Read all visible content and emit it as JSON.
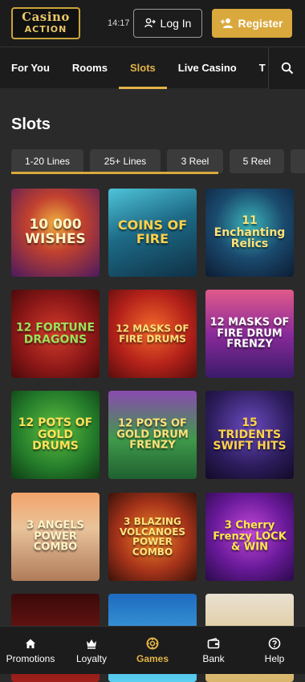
{
  "header": {
    "logo_line1": "Casino",
    "logo_line2": "ACTION",
    "time": "14:17",
    "login_label": "Log In",
    "register_label": "Register"
  },
  "nav": {
    "items": [
      "For You",
      "Rooms",
      "Slots",
      "Live Casino",
      "T"
    ],
    "active": "Slots"
  },
  "page_title": "Slots",
  "filters": [
    "1-20 Lines",
    "25+ Lines",
    "3 Reel",
    "5 Reel"
  ],
  "games": [
    {
      "title": "10 000 WISHES"
    },
    {
      "title": "COINS OF FIRE"
    },
    {
      "title": "11 Enchanting Relics"
    },
    {
      "title": "12 FORTUNE DRAGONS"
    },
    {
      "title": "12 MASKS OF FIRE DRUMS"
    },
    {
      "title": "12 MASKS OF FIRE DRUM FRENZY"
    },
    {
      "title": "12 POTS OF GOLD DRUMS"
    },
    {
      "title": "12 POTS OF GOLD DRUM FRENZY"
    },
    {
      "title": "15 TRIDENTS SWIFT HITS"
    },
    {
      "title": "3 ANGELS POWER COMBO"
    },
    {
      "title": "3 BLAZING VOLCANOES POWER COMBO"
    },
    {
      "title": "3 Cherry Frenzy LOCK & WIN"
    },
    {
      "title": ""
    },
    {
      "title": ""
    },
    {
      "title": ""
    }
  ],
  "bottom_nav": [
    {
      "label": "Promotions",
      "icon": "home-icon"
    },
    {
      "label": "Loyalty",
      "icon": "crown-icon"
    },
    {
      "label": "Games",
      "icon": "chip-icon"
    },
    {
      "label": "Bank",
      "icon": "wallet-icon"
    },
    {
      "label": "Help",
      "icon": "help-icon"
    }
  ],
  "colors": {
    "accent": "#d9a93d",
    "background": "#2a2a2a",
    "header": "#1c1c1c"
  }
}
